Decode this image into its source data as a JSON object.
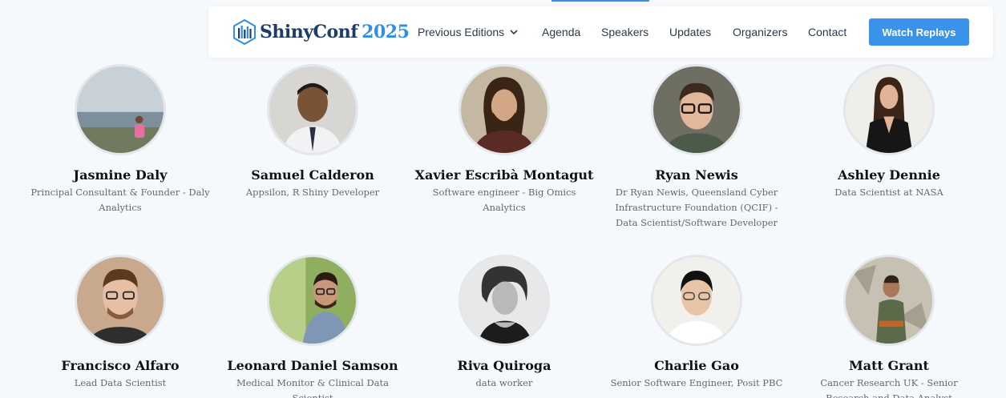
{
  "header": {
    "logo_name": "ShinyConf",
    "logo_year": "2025",
    "nav": [
      {
        "label": "Previous Editions"
      },
      {
        "label": "Agenda"
      },
      {
        "label": "Speakers"
      },
      {
        "label": "Updates"
      },
      {
        "label": "Organizers"
      },
      {
        "label": "Contact"
      }
    ],
    "cta_label": "Watch Replays"
  },
  "speakers": [
    {
      "name": "Jasmine Daly",
      "role": "Principal Consultant & Founder - Daly Analytics"
    },
    {
      "name": "Samuel Calderon",
      "role": "Appsilon, R Shiny Developer"
    },
    {
      "name": "Xavier Escribà Montagut",
      "role": "Software engineer - Big Omics Analytics"
    },
    {
      "name": "Ryan Newis",
      "role": "Dr Ryan Newis, Queensland Cyber Infrastructure Foundation (QCIF) - Data Scientist/Software Developer"
    },
    {
      "name": "Ashley Dennie",
      "role": "Data Scientist at NASA"
    },
    {
      "name": "Francisco Alfaro",
      "role": "Lead Data Scientist"
    },
    {
      "name": "Leonard Daniel Samson",
      "role": "Medical Monitor & Clinical Data Scientist"
    },
    {
      "name": "Riva Quiroga",
      "role": "data worker"
    },
    {
      "name": "Charlie Gao",
      "role": "Senior Software Engineer, Posit PBC"
    },
    {
      "name": "Matt Grant",
      "role": "Cancer Research UK - Senior Research and Data Analyst"
    }
  ],
  "colors": {
    "accent": "#3a93ea",
    "logo_dark": "#1d3c66",
    "background": "#f6f9fc"
  },
  "icons": {
    "logo": "shinyconf-logo-icon",
    "dropdown": "chevron-down-icon"
  }
}
